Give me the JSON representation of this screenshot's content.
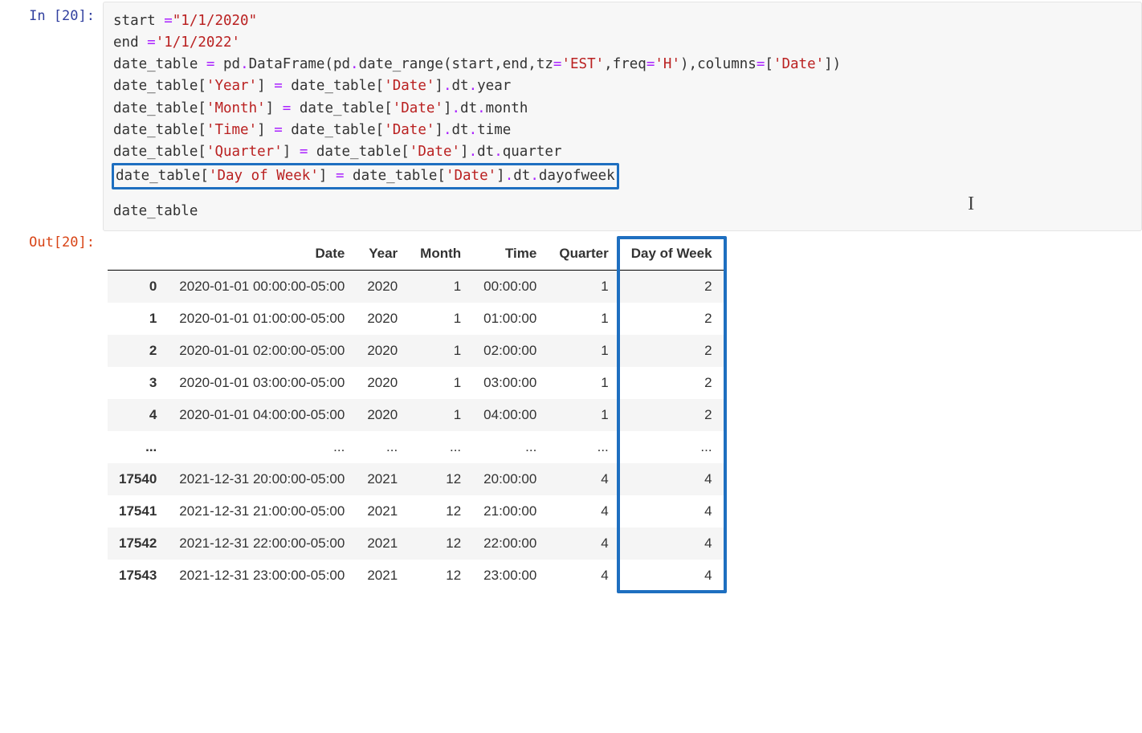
{
  "prompts": {
    "in": "In [20]:",
    "out": "Out[20]:"
  },
  "code": {
    "l1a": "start ",
    "l1op": "=",
    "l1b": "\"1/1/2020\"",
    "l2a": "end ",
    "l2op": "=",
    "l2b": "'1/1/2022'",
    "l3a": "date_table ",
    "l3op": "=",
    "l3b": " pd",
    "l3dot": ".",
    "l3c": "DataFrame(pd",
    "l3dot2": ".",
    "l3d": "date_range(start,end,tz",
    "l3op2": "=",
    "l3e": "'EST'",
    "l3f": ",freq",
    "l3op3": "=",
    "l3g": "'H'",
    "l3h": "),columns",
    "l3op4": "=",
    "l3i": "[",
    "l3j": "'Date'",
    "l3k": "])",
    "l4a": "date_table[",
    "l4s1": "'Year'",
    "l4b": "] ",
    "l4op": "=",
    "l4c": " date_table[",
    "l4s2": "'Date'",
    "l4d": "]",
    "l4e": ".dt.year",
    "l5a": "date_table[",
    "l5s1": "'Month'",
    "l5b": "] ",
    "l5op": "=",
    "l5c": " date_table[",
    "l5s2": "'Date'",
    "l5d": "]",
    "l5e": ".dt.month",
    "l6a": "date_table[",
    "l6s1": "'Time'",
    "l6b": "] ",
    "l6op": "=",
    "l6c": " date_table[",
    "l6s2": "'Date'",
    "l6d": "]",
    "l6e": ".dt.time",
    "l7a": "date_table[",
    "l7s1": "'Quarter'",
    "l7b": "] ",
    "l7op": "=",
    "l7c": " date_table[",
    "l7s2": "'Date'",
    "l7d": "]",
    "l7e": ".dt.quarter",
    "l8a": "date_table[",
    "l8s1": "'Day of Week'",
    "l8b": "] ",
    "l8op": "=",
    "l8c": " date_table[",
    "l8s2": "'Date'",
    "l8d": "]",
    "l8e": ".dt.dayofweek",
    "l9": "date_table"
  },
  "cursor": "I",
  "table": {
    "columns": [
      "",
      "Date",
      "Year",
      "Month",
      "Time",
      "Quarter",
      "Day of Week"
    ],
    "rows": [
      {
        "idx": "0",
        "Date": "2020-01-01 00:00:00-05:00",
        "Year": "2020",
        "Month": "1",
        "Time": "00:00:00",
        "Quarter": "1",
        "Day of Week": "2"
      },
      {
        "idx": "1",
        "Date": "2020-01-01 01:00:00-05:00",
        "Year": "2020",
        "Month": "1",
        "Time": "01:00:00",
        "Quarter": "1",
        "Day of Week": "2"
      },
      {
        "idx": "2",
        "Date": "2020-01-01 02:00:00-05:00",
        "Year": "2020",
        "Month": "1",
        "Time": "02:00:00",
        "Quarter": "1",
        "Day of Week": "2"
      },
      {
        "idx": "3",
        "Date": "2020-01-01 03:00:00-05:00",
        "Year": "2020",
        "Month": "1",
        "Time": "03:00:00",
        "Quarter": "1",
        "Day of Week": "2"
      },
      {
        "idx": "4",
        "Date": "2020-01-01 04:00:00-05:00",
        "Year": "2020",
        "Month": "1",
        "Time": "04:00:00",
        "Quarter": "1",
        "Day of Week": "2"
      },
      {
        "idx": "...",
        "Date": "...",
        "Year": "...",
        "Month": "...",
        "Time": "...",
        "Quarter": "...",
        "Day of Week": "..."
      },
      {
        "idx": "17540",
        "Date": "2021-12-31 20:00:00-05:00",
        "Year": "2021",
        "Month": "12",
        "Time": "20:00:00",
        "Quarter": "4",
        "Day of Week": "4"
      },
      {
        "idx": "17541",
        "Date": "2021-12-31 21:00:00-05:00",
        "Year": "2021",
        "Month": "12",
        "Time": "21:00:00",
        "Quarter": "4",
        "Day of Week": "4"
      },
      {
        "idx": "17542",
        "Date": "2021-12-31 22:00:00-05:00",
        "Year": "2021",
        "Month": "12",
        "Time": "22:00:00",
        "Quarter": "4",
        "Day of Week": "4"
      },
      {
        "idx": "17543",
        "Date": "2021-12-31 23:00:00-05:00",
        "Year": "2021",
        "Month": "12",
        "Time": "23:00:00",
        "Quarter": "4",
        "Day of Week": "4"
      }
    ]
  }
}
